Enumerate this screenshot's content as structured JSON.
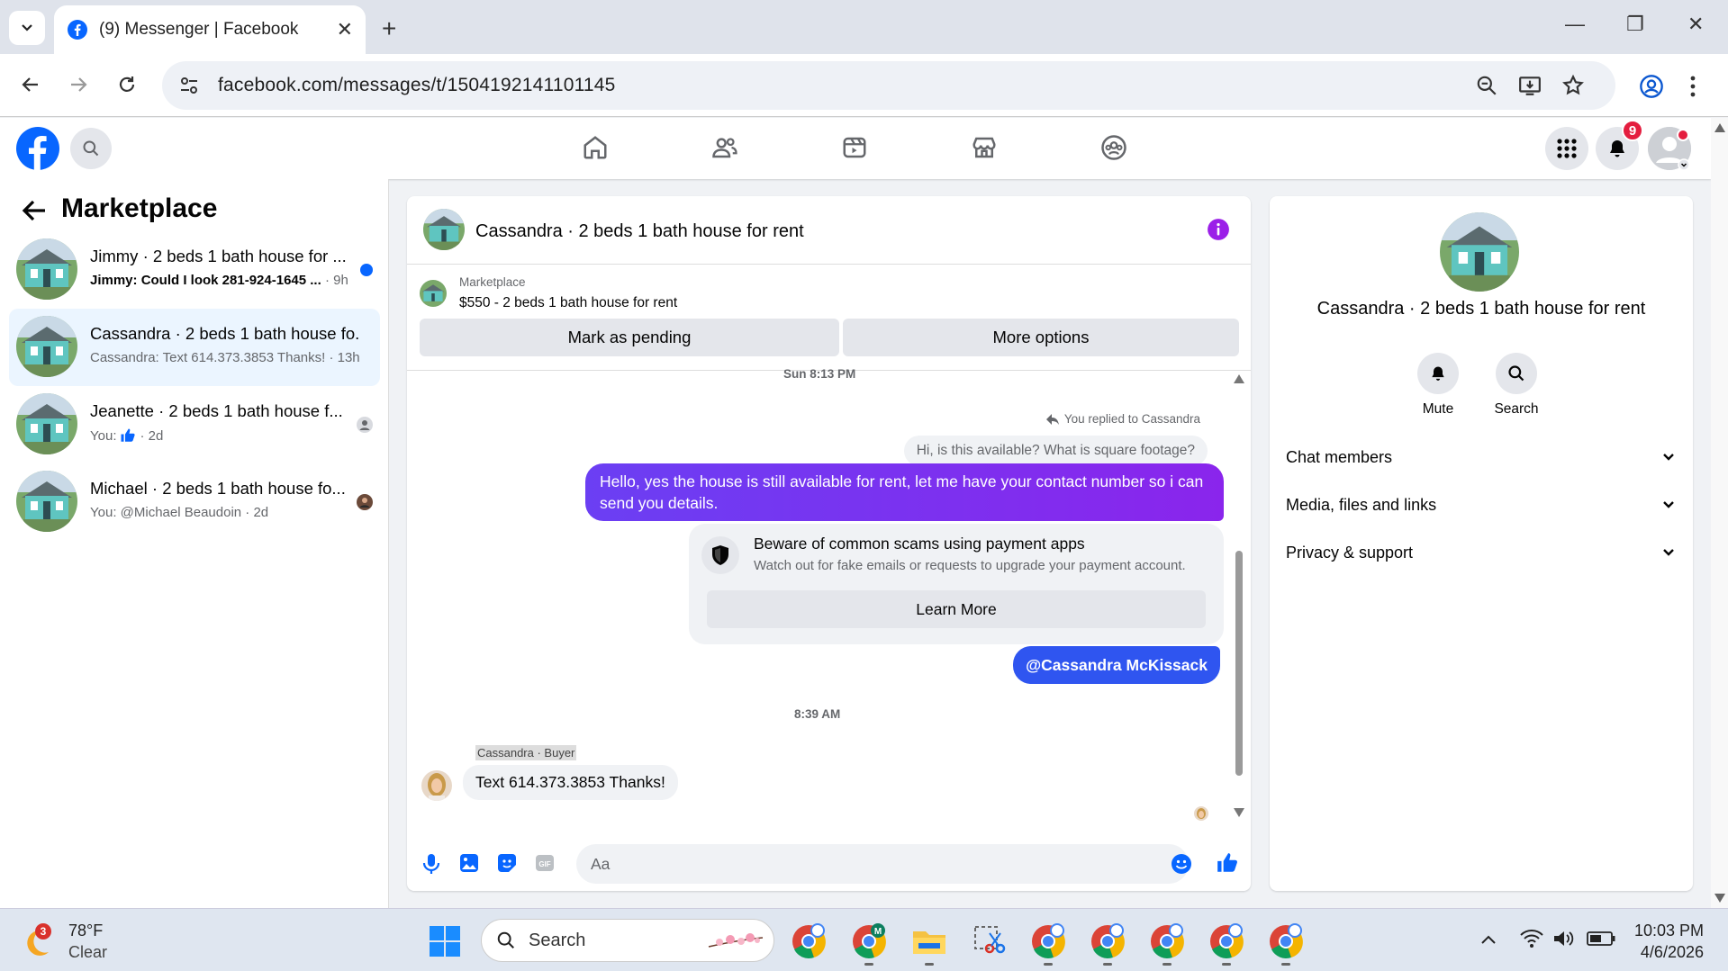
{
  "browser": {
    "tab_title": "(9) Messenger | Facebook",
    "url": "facebook.com/messages/t/1504192141101145"
  },
  "fb_nav": {
    "notification_count": "9",
    "accent": "#0866ff"
  },
  "sidebar": {
    "title": "Marketplace",
    "conversations": [
      {
        "name": "Jimmy · 2 beds 1 bath house for ...",
        "preview": "Jimmy: Could I look 281-924-1645 ...",
        "time": "· 9h",
        "unread": true
      },
      {
        "name": "Cassandra · 2 beds 1 bath house fo...",
        "preview": "Cassandra: Text 614.373.3853 Thanks! · 13h",
        "time": "",
        "active": true
      },
      {
        "name": "Jeanette · 2 beds 1 bath house f...",
        "preview": "You:",
        "time": "· 2d"
      },
      {
        "name": "Michael · 2 beds 1 bath house fo...",
        "preview": "You: @Michael Beaudoin · 2d",
        "time": ""
      }
    ]
  },
  "chat": {
    "title": "Cassandra · 2 beds 1 bath house for rent",
    "listing_label": "Marketplace",
    "listing_detail": "$550 - 2 beds 1 bath house for rent",
    "mark_pending": "Mark as pending",
    "more_options": "More options",
    "timestamp_1": "Sun 8:13 PM",
    "replied_to": "You replied to Cassandra",
    "quoted_message": "Hi, is this available? What is square footage?",
    "outgoing_message": "Hello, yes the house is still available for rent, let me have your contact number so i can send you details.",
    "scam_title": "Beware of common scams using payment apps",
    "scam_desc": "Watch out for fake emails or requests to upgrade your payment account.",
    "learn_more": "Learn More",
    "mention_message": "@Cassandra McKissack",
    "timestamp_2": "8:39 AM",
    "sender_label": "Cassandra · Buyer",
    "incoming_message": "Text 614.373.3853 Thanks!",
    "input_placeholder": "Aa",
    "outgoing_color": "#7b2ff0"
  },
  "info": {
    "name": "Cassandra · 2 beds 1 bath house for rent",
    "mute_label": "Mute",
    "search_label": "Search",
    "sections": [
      "Chat members",
      "Media, files and links",
      "Privacy & support"
    ]
  },
  "taskbar": {
    "weather_badge": "3",
    "weather_temp": "78°F",
    "weather_desc": "Clear",
    "search_label": "Search",
    "time": "10:03 PM",
    "date": "4/6/2026"
  }
}
